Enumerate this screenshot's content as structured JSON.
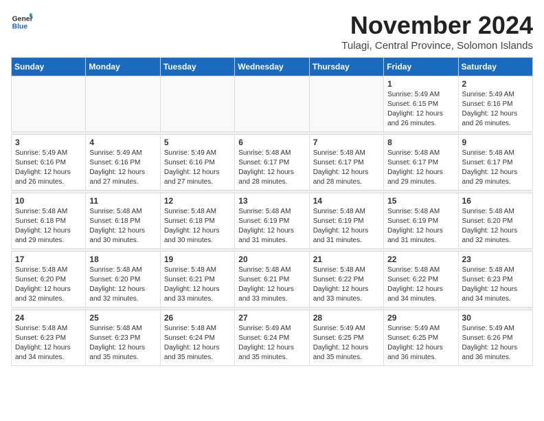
{
  "logo": {
    "general": "General",
    "blue": "Blue"
  },
  "title": "November 2024",
  "subtitle": "Tulagi, Central Province, Solomon Islands",
  "weekdays": [
    "Sunday",
    "Monday",
    "Tuesday",
    "Wednesday",
    "Thursday",
    "Friday",
    "Saturday"
  ],
  "weeks": [
    [
      {
        "day": "",
        "detail": ""
      },
      {
        "day": "",
        "detail": ""
      },
      {
        "day": "",
        "detail": ""
      },
      {
        "day": "",
        "detail": ""
      },
      {
        "day": "",
        "detail": ""
      },
      {
        "day": "1",
        "detail": "Sunrise: 5:49 AM\nSunset: 6:15 PM\nDaylight: 12 hours and 26 minutes."
      },
      {
        "day": "2",
        "detail": "Sunrise: 5:49 AM\nSunset: 6:16 PM\nDaylight: 12 hours and 26 minutes."
      }
    ],
    [
      {
        "day": "3",
        "detail": "Sunrise: 5:49 AM\nSunset: 6:16 PM\nDaylight: 12 hours and 26 minutes."
      },
      {
        "day": "4",
        "detail": "Sunrise: 5:49 AM\nSunset: 6:16 PM\nDaylight: 12 hours and 27 minutes."
      },
      {
        "day": "5",
        "detail": "Sunrise: 5:49 AM\nSunset: 6:16 PM\nDaylight: 12 hours and 27 minutes."
      },
      {
        "day": "6",
        "detail": "Sunrise: 5:48 AM\nSunset: 6:17 PM\nDaylight: 12 hours and 28 minutes."
      },
      {
        "day": "7",
        "detail": "Sunrise: 5:48 AM\nSunset: 6:17 PM\nDaylight: 12 hours and 28 minutes."
      },
      {
        "day": "8",
        "detail": "Sunrise: 5:48 AM\nSunset: 6:17 PM\nDaylight: 12 hours and 29 minutes."
      },
      {
        "day": "9",
        "detail": "Sunrise: 5:48 AM\nSunset: 6:17 PM\nDaylight: 12 hours and 29 minutes."
      }
    ],
    [
      {
        "day": "10",
        "detail": "Sunrise: 5:48 AM\nSunset: 6:18 PM\nDaylight: 12 hours and 29 minutes."
      },
      {
        "day": "11",
        "detail": "Sunrise: 5:48 AM\nSunset: 6:18 PM\nDaylight: 12 hours and 30 minutes."
      },
      {
        "day": "12",
        "detail": "Sunrise: 5:48 AM\nSunset: 6:18 PM\nDaylight: 12 hours and 30 minutes."
      },
      {
        "day": "13",
        "detail": "Sunrise: 5:48 AM\nSunset: 6:19 PM\nDaylight: 12 hours and 31 minutes."
      },
      {
        "day": "14",
        "detail": "Sunrise: 5:48 AM\nSunset: 6:19 PM\nDaylight: 12 hours and 31 minutes."
      },
      {
        "day": "15",
        "detail": "Sunrise: 5:48 AM\nSunset: 6:19 PM\nDaylight: 12 hours and 31 minutes."
      },
      {
        "day": "16",
        "detail": "Sunrise: 5:48 AM\nSunset: 6:20 PM\nDaylight: 12 hours and 32 minutes."
      }
    ],
    [
      {
        "day": "17",
        "detail": "Sunrise: 5:48 AM\nSunset: 6:20 PM\nDaylight: 12 hours and 32 minutes."
      },
      {
        "day": "18",
        "detail": "Sunrise: 5:48 AM\nSunset: 6:20 PM\nDaylight: 12 hours and 32 minutes."
      },
      {
        "day": "19",
        "detail": "Sunrise: 5:48 AM\nSunset: 6:21 PM\nDaylight: 12 hours and 33 minutes."
      },
      {
        "day": "20",
        "detail": "Sunrise: 5:48 AM\nSunset: 6:21 PM\nDaylight: 12 hours and 33 minutes."
      },
      {
        "day": "21",
        "detail": "Sunrise: 5:48 AM\nSunset: 6:22 PM\nDaylight: 12 hours and 33 minutes."
      },
      {
        "day": "22",
        "detail": "Sunrise: 5:48 AM\nSunset: 6:22 PM\nDaylight: 12 hours and 34 minutes."
      },
      {
        "day": "23",
        "detail": "Sunrise: 5:48 AM\nSunset: 6:23 PM\nDaylight: 12 hours and 34 minutes."
      }
    ],
    [
      {
        "day": "24",
        "detail": "Sunrise: 5:48 AM\nSunset: 6:23 PM\nDaylight: 12 hours and 34 minutes."
      },
      {
        "day": "25",
        "detail": "Sunrise: 5:48 AM\nSunset: 6:23 PM\nDaylight: 12 hours and 35 minutes."
      },
      {
        "day": "26",
        "detail": "Sunrise: 5:48 AM\nSunset: 6:24 PM\nDaylight: 12 hours and 35 minutes."
      },
      {
        "day": "27",
        "detail": "Sunrise: 5:49 AM\nSunset: 6:24 PM\nDaylight: 12 hours and 35 minutes."
      },
      {
        "day": "28",
        "detail": "Sunrise: 5:49 AM\nSunset: 6:25 PM\nDaylight: 12 hours and 35 minutes."
      },
      {
        "day": "29",
        "detail": "Sunrise: 5:49 AM\nSunset: 6:25 PM\nDaylight: 12 hours and 36 minutes."
      },
      {
        "day": "30",
        "detail": "Sunrise: 5:49 AM\nSunset: 6:26 PM\nDaylight: 12 hours and 36 minutes."
      }
    ]
  ]
}
